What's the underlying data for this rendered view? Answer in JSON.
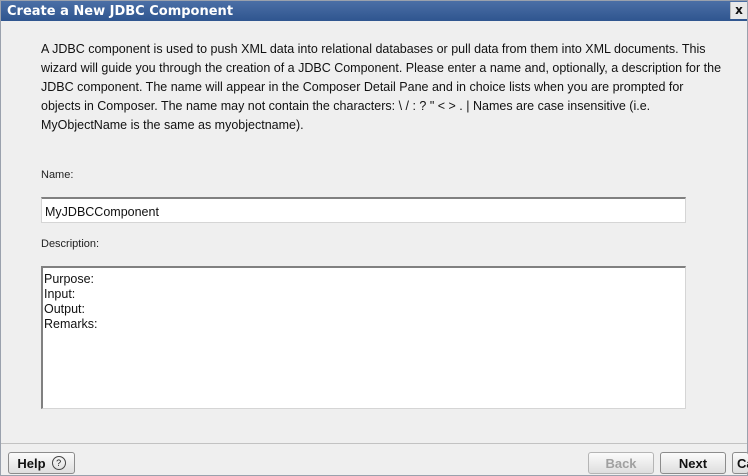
{
  "window": {
    "title": "Create a New JDBC Component",
    "close_glyph": "x"
  },
  "intro": {
    "text": "A JDBC component is used to push XML data into relational databases or pull data from them into XML documents.  This wizard will guide you through the creation of a JDBC Component.  Please enter a name and, optionally, a description for the JDBC component.  The name will appear in the Composer Detail Pane and in choice lists when you are prompted for objects in Composer.  The name may not contain the characters: \\ / : ? \" < > . |  Names are case insensitive (i.e. MyObjectName is the same as myobjectname)."
  },
  "form": {
    "name_label": "Name:",
    "name_value": "MyJDBCComponent",
    "description_label": "Description:",
    "description_lines": [
      "Purpose:",
      "Input:",
      "Output:",
      "Remarks:"
    ]
  },
  "buttons": {
    "help": "Help",
    "help_icon": "?",
    "back": "Back",
    "next": "Next",
    "cancel": "Cancel"
  }
}
